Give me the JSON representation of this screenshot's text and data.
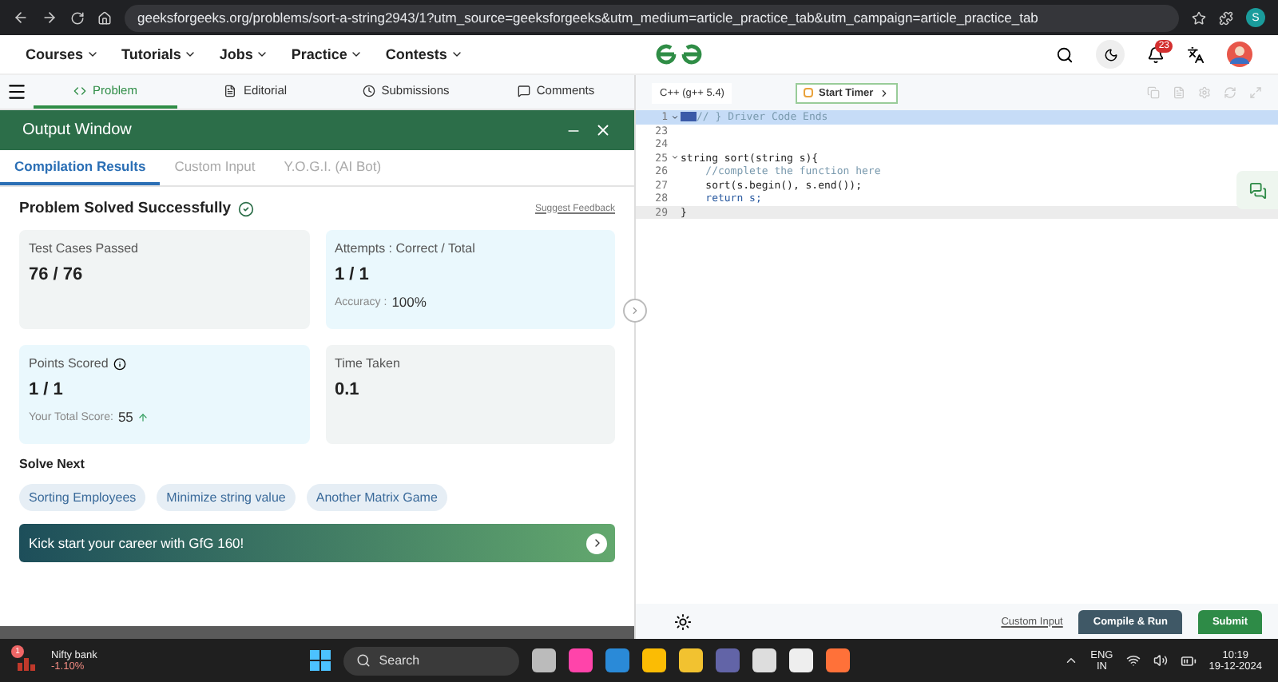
{
  "browser": {
    "url": "geeksforgeeks.org/problems/sort-a-string2943/1?utm_source=geeksforgeeks&utm_medium=article_practice_tab&utm_campaign=article_practice_tab",
    "profile": "S"
  },
  "nav": {
    "items": [
      "Courses",
      "Tutorials",
      "Jobs",
      "Practice",
      "Contests"
    ],
    "notifications": "23"
  },
  "problem_tabs": [
    {
      "label": "Problem",
      "selected": true
    },
    {
      "label": "Editorial",
      "selected": false
    },
    {
      "label": "Submissions",
      "selected": false
    },
    {
      "label": "Comments",
      "selected": false
    }
  ],
  "output_window": {
    "title": "Output Window",
    "tabs": [
      {
        "label": "Compilation Results",
        "selected": true
      },
      {
        "label": "Custom Input",
        "selected": false
      },
      {
        "label": "Y.O.G.I. (AI Bot)",
        "selected": false
      }
    ],
    "status": "Problem Solved Successfully",
    "feedback_link": "Suggest Feedback",
    "cards": [
      {
        "kind": "neutral",
        "label": "Test Cases Passed",
        "value": "76 / 76"
      },
      {
        "kind": "highlight",
        "label": "Attempts : Correct / Total",
        "value": "1 / 1",
        "note_label": "Accuracy :",
        "note_value": "100%"
      },
      {
        "kind": "highlight",
        "label": "Points Scored",
        "value": "1 / 1",
        "note_label": "Your Total Score:",
        "note_value": "55",
        "info": true,
        "trend_up": true
      },
      {
        "kind": "neutral",
        "label": "Time Taken",
        "value": "0.1"
      }
    ],
    "solve_next": {
      "heading": "Solve Next",
      "items": [
        "Sorting Employees",
        "Minimize string value",
        "Another Matrix Game"
      ]
    },
    "banner": "Kick start your career with GfG 160!"
  },
  "editor": {
    "language": "C++ (g++ 5.4)",
    "timer": "Start Timer",
    "lines": [
      {
        "number": "1",
        "code": "// } Driver Code Ends",
        "kind": "comment",
        "highlighted": true,
        "fold": true,
        "current": false
      },
      {
        "number": "23",
        "highlighted": false,
        "fold": false
      },
      {
        "number": "24",
        "highlighted": false,
        "fold": false
      },
      {
        "number": "25",
        "code": "string sort(string s){",
        "kind": "code",
        "highlighted": false,
        "fold": true
      },
      {
        "number": "26",
        "code": "    //complete the function here",
        "kind": "comment",
        "highlighted": false,
        "fold": false
      },
      {
        "number": "27",
        "code": "    sort(s.begin(), s.end());",
        "kind": "code",
        "highlighted": false,
        "fold": false
      },
      {
        "number": "28",
        "code": "    return s;",
        "kind": "keyword",
        "highlighted": false,
        "fold": false
      },
      {
        "number": "29",
        "code": "}",
        "kind": "code",
        "highlighted": false,
        "fold": false,
        "current": true
      }
    ],
    "custom_input": "Custom Input",
    "compile": "Compile & Run",
    "submit": "Submit"
  },
  "taskbar": {
    "ticker": {
      "name": "Nifty bank",
      "change": "-1.10%",
      "badge": "1"
    },
    "search": "Search",
    "language": "ENG",
    "region": "IN",
    "time": "10:19",
    "date": "19-12-2024"
  }
}
